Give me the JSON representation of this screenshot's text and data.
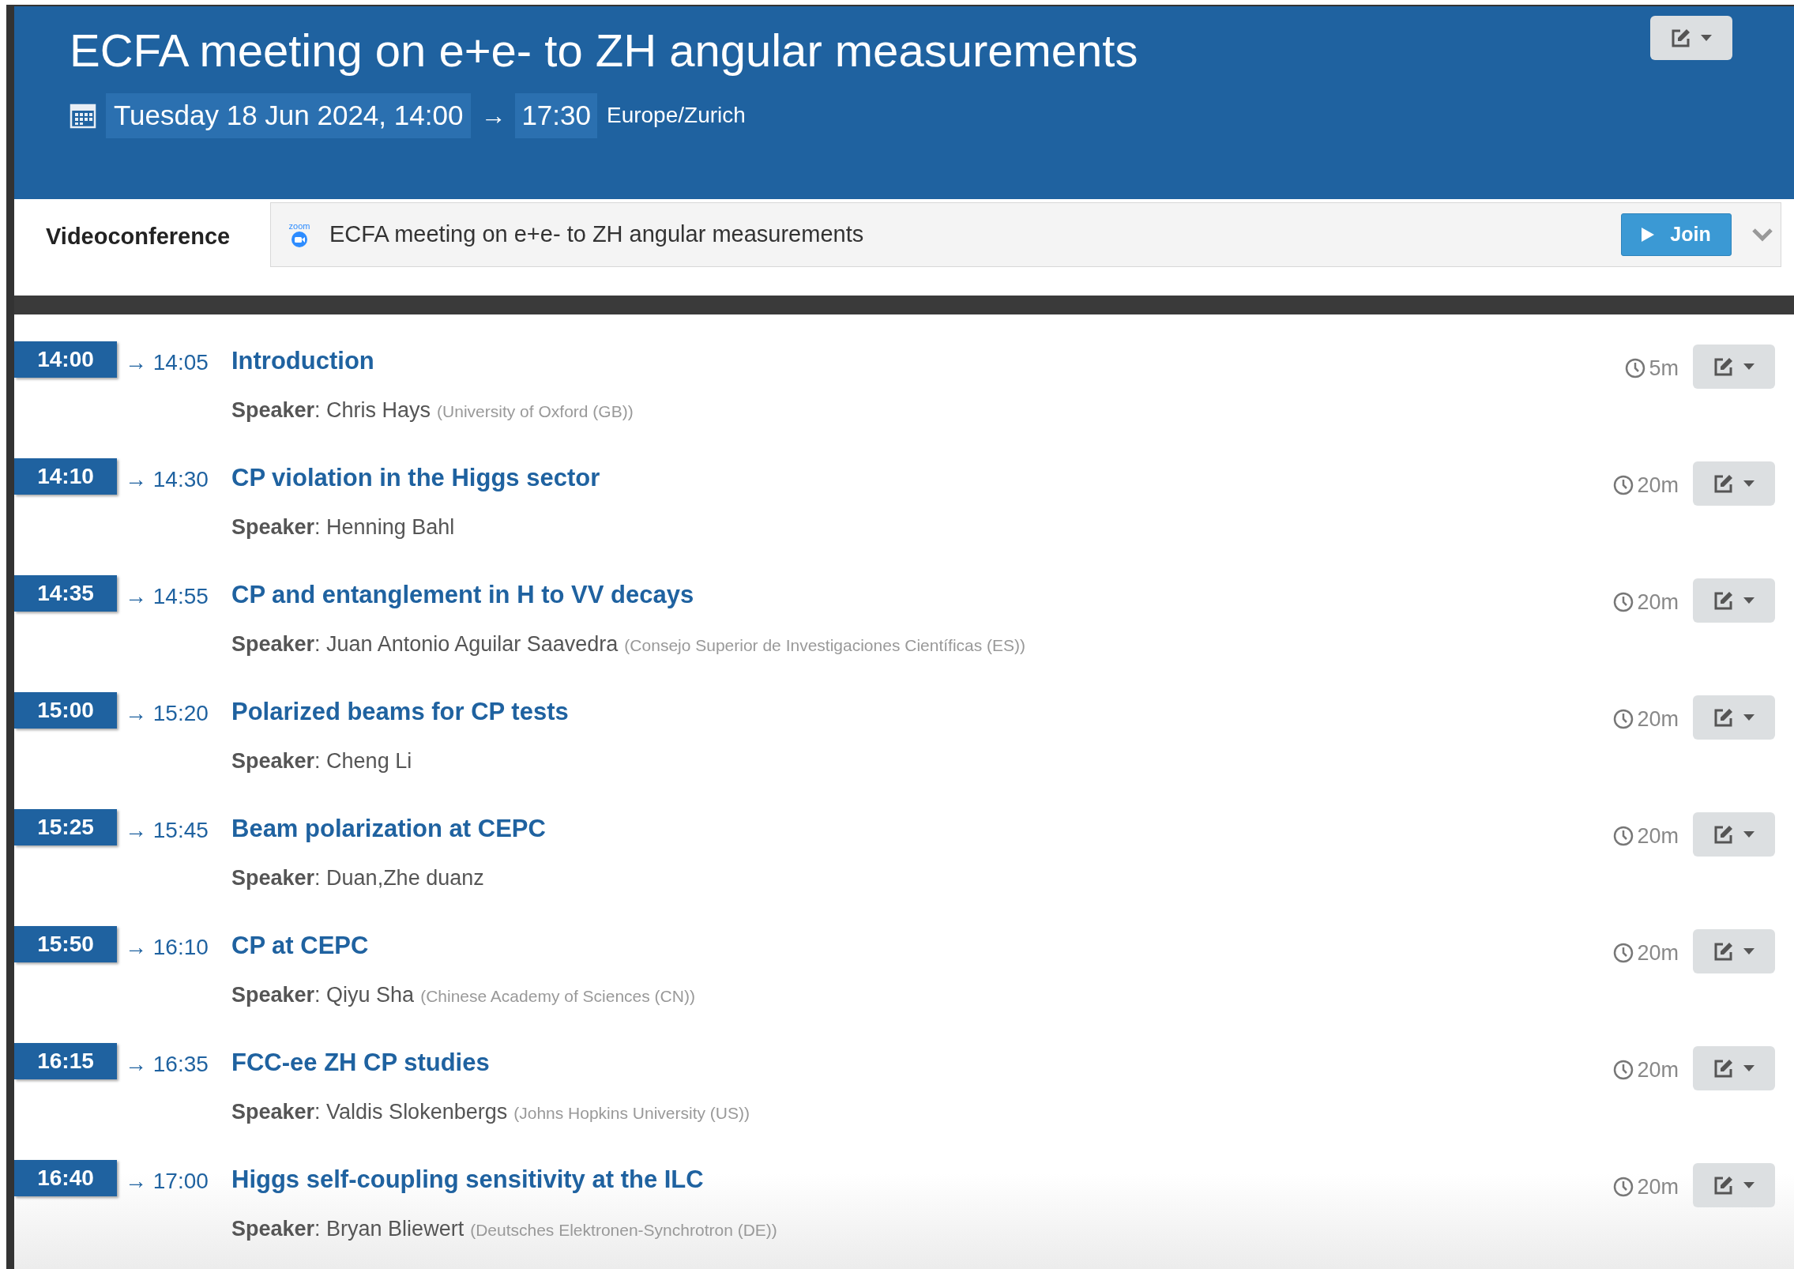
{
  "event": {
    "title": "ECFA meeting on e+e- to ZH angular measurements",
    "start": "Tuesday 18 Jun 2024, 14:00",
    "arrow": "→",
    "end": "17:30",
    "timezone": "Europe/Zurich"
  },
  "videoconference": {
    "label": "Videoconference",
    "logo_text": "zoom",
    "room": "ECFA meeting on e+e- to ZH angular measurements",
    "join": "Join"
  },
  "timetable": [
    {
      "start": "14:00",
      "end": "→ 14:05",
      "title": "Introduction",
      "speaker": "**Speaker**: Chris Hays",
      "affiliation": "(University of Oxford (GB))",
      "duration": "5m"
    },
    {
      "start": "14:10",
      "end": "→ 14:30",
      "title": "CP violation in the Higgs sector",
      "speaker": "**Speaker**: Henning Bahl",
      "duration": "20m"
    },
    {
      "start": "14:35",
      "end": "→ 14:55",
      "title": "CP and entanglement in H to VV decays",
      "speaker": "**Speaker**: Juan Antonio Aguilar Saavedra",
      "affiliation": "(Consejo Superior de Investigaciones Científicas (ES))",
      "duration": "20m"
    },
    {
      "start": "15:00",
      "end": "→ 15:20",
      "title": "Polarized beams for CP tests",
      "speaker": "**Speaker**: Cheng Li",
      "duration": "20m"
    },
    {
      "start": "15:25",
      "end": "→ 15:45",
      "title": "Beam polarization at CEPC",
      "speaker": "**Speaker**: Duan,Zhe duanz",
      "duration": "20m"
    },
    {
      "start": "15:50",
      "end": "→ 16:10",
      "title": "CP at CEPC",
      "speaker": "**Speaker**: Qiyu Sha",
      "affiliation": "(Chinese Academy of Sciences (CN))",
      "duration": "20m"
    },
    {
      "start": "16:15",
      "end": "→ 16:35",
      "title": "FCC-ee ZH CP studies",
      "speaker": "**Speaker**: Valdis Slokenbergs",
      "affiliation": "(Johns Hopkins University (US))",
      "duration": "20m"
    },
    {
      "start": "16:40",
      "end": "→ 17:00",
      "title": "Higgs self-coupling sensitivity at the ILC",
      "speaker": "**Speaker**: Bryan Bliewert",
      "affiliation": "(Deutsches Elektronen-Synchrotron (DE))",
      "duration": "20m"
    }
  ]
}
